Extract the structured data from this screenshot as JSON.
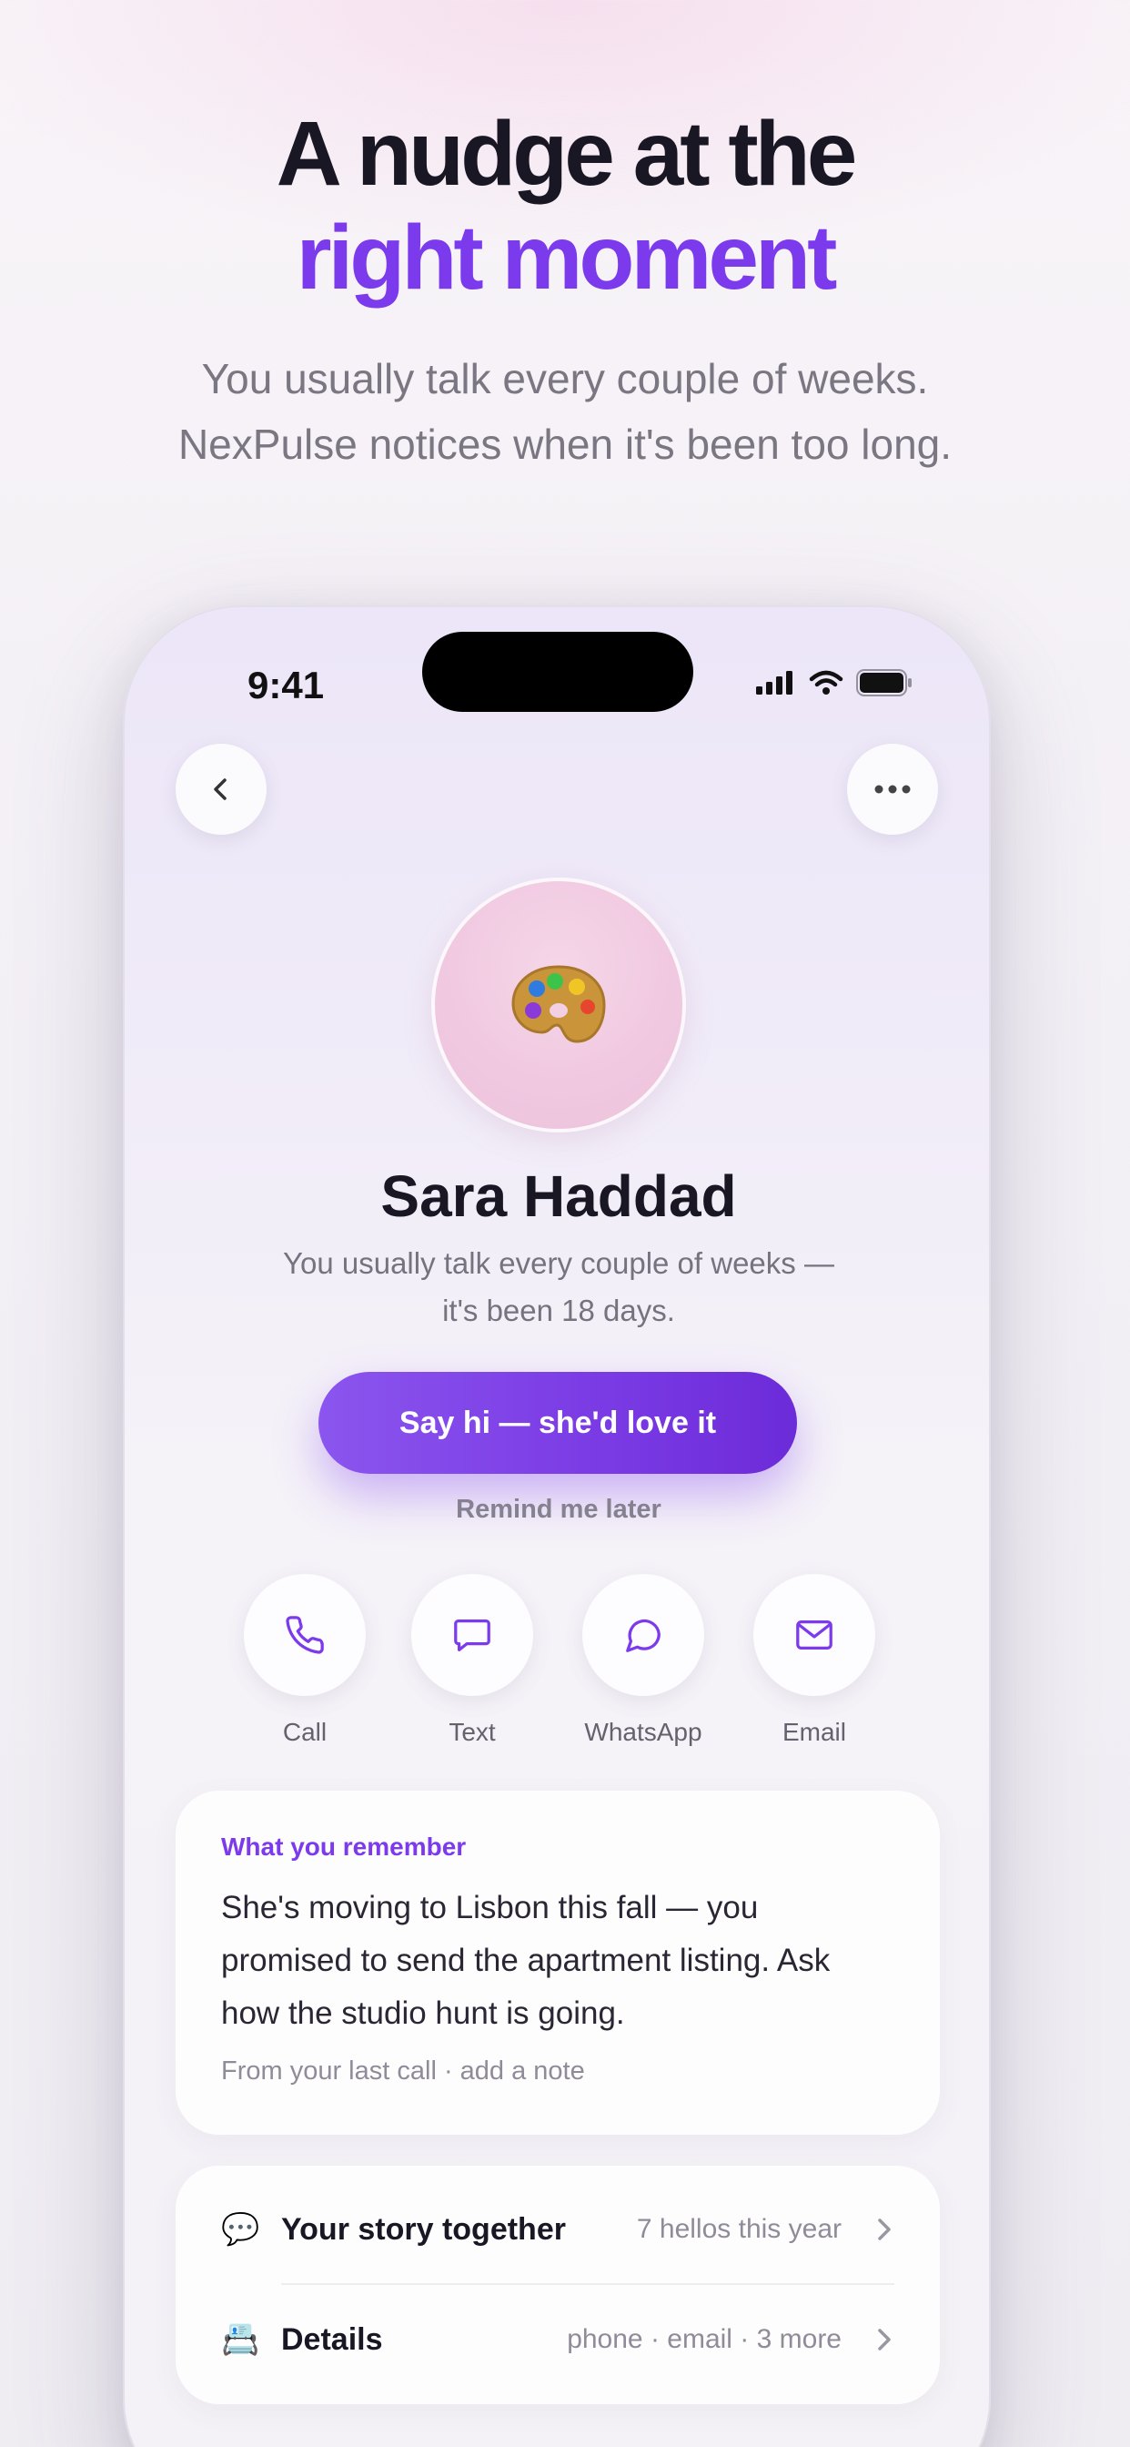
{
  "hero": {
    "headline_line1": "A nudge at the",
    "headline_line2": "right moment",
    "subhead_line1": "You usually talk every couple of weeks.",
    "subhead_line2": "NexPulse notices when it's been too long."
  },
  "status_bar": {
    "time": "9:41"
  },
  "contact": {
    "avatar_emoji": "🎨",
    "name": "Sara Haddad",
    "cadence_line1": "You usually talk every couple of weeks —",
    "cadence_line2": "it's been 18 days."
  },
  "cta": {
    "primary_label": "Say hi — she'd love it",
    "secondary_label": "Remind me later"
  },
  "actions": [
    {
      "label": "Call",
      "icon": "phone-icon"
    },
    {
      "label": "Text",
      "icon": "message-square-icon"
    },
    {
      "label": "WhatsApp",
      "icon": "message-circle-icon"
    },
    {
      "label": "Email",
      "icon": "mail-icon"
    }
  ],
  "memory": {
    "eyebrow": "What you remember",
    "body": "She's moving to Lisbon this fall — you promised to send the apartment listing. Ask how the studio hunt is going.",
    "footer": "From your last call · add a note"
  },
  "info_rows": [
    {
      "emoji": "💬",
      "title": "Your story together",
      "meta": "7 hellos this year"
    },
    {
      "emoji": "📇",
      "title": "Details",
      "meta": "phone · email · 3 more"
    }
  ],
  "colors": {
    "accent": "#7c3aed",
    "headline": "#1a1725",
    "muted": "#7a7682"
  }
}
